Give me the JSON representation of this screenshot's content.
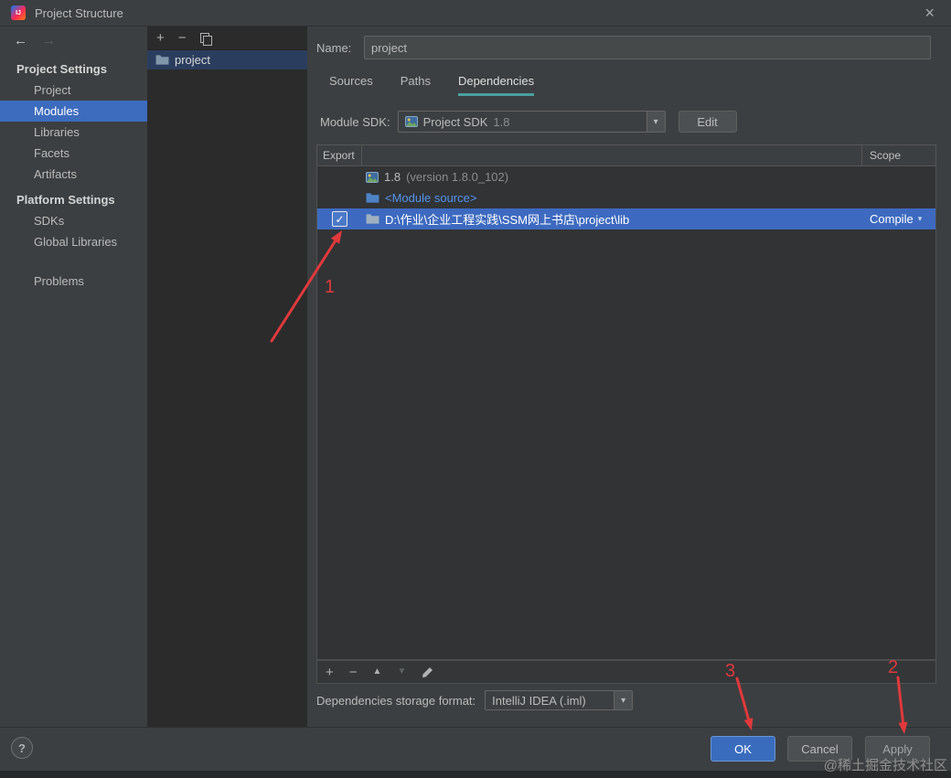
{
  "window": {
    "title": "Project Structure",
    "logo_text": "IJ"
  },
  "icons": {
    "close": "×",
    "back": "←",
    "forward": "→",
    "add": "+",
    "remove": "−",
    "move_up": "▲",
    "move_down": "▼",
    "dropdown": "▾",
    "check": "✓",
    "help": "?"
  },
  "sidebar": {
    "sections": [
      {
        "header": "Project Settings",
        "items": [
          {
            "label": "Project"
          },
          {
            "label": "Modules",
            "selected": true
          },
          {
            "label": "Libraries"
          },
          {
            "label": "Facets"
          },
          {
            "label": "Artifacts"
          }
        ]
      },
      {
        "header": "Platform Settings",
        "items": [
          {
            "label": "SDKs"
          },
          {
            "label": "Global Libraries"
          }
        ]
      },
      {
        "header": "",
        "items": [
          {
            "label": "Problems"
          }
        ]
      }
    ]
  },
  "modules_panel": {
    "selected_module": "project"
  },
  "editor": {
    "name_label": "Name:",
    "name_value": "project",
    "tabs": [
      {
        "label": "Sources"
      },
      {
        "label": "Paths"
      },
      {
        "label": "Dependencies",
        "active": true
      }
    ],
    "sdk": {
      "label": "Module SDK:",
      "value": "Project SDK",
      "version": "1.8",
      "edit_button": "Edit"
    },
    "dependencies_table": {
      "columns": {
        "export": "Export",
        "scope": "Scope"
      },
      "rows": [
        {
          "kind": "sdk",
          "name": "1.8",
          "detail": "(version 1.8.0_102)"
        },
        {
          "kind": "module-source",
          "name": "<Module source>"
        },
        {
          "kind": "library",
          "name": "D:\\作业\\企业工程实践\\SSM网上书店\\project\\lib",
          "export": true,
          "scope": "Compile",
          "selected": true
        }
      ]
    },
    "storage": {
      "label": "Dependencies storage format:",
      "value": "IntelliJ IDEA (.iml)"
    }
  },
  "footer": {
    "ok_button": "OK",
    "cancel_button": "Cancel",
    "apply_button": "Apply"
  },
  "annotations": {
    "color": "#e0393c",
    "items": [
      {
        "label": "1"
      },
      {
        "label": "2"
      },
      {
        "label": "3"
      }
    ]
  },
  "watermark": "@稀土掘金技术社区"
}
